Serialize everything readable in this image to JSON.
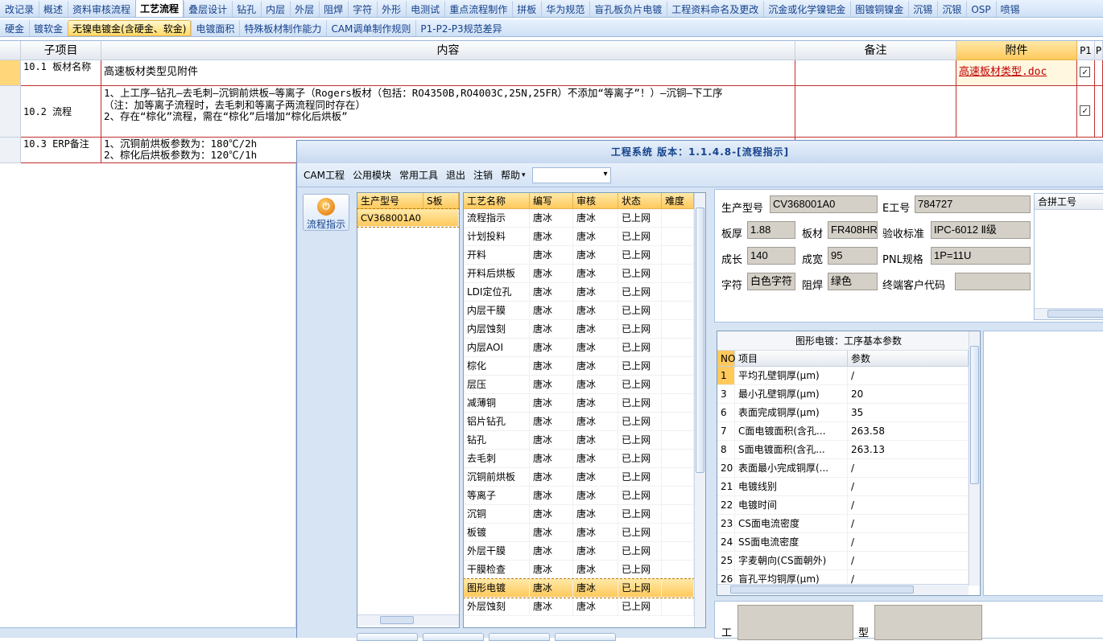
{
  "tabs_row1": [
    "改记录",
    "概述",
    "资料审核流程",
    "工艺流程",
    "叠层设计",
    "钻孔",
    "内层",
    "外层",
    "阻焊",
    "字符",
    "外形",
    "电测试",
    "重点流程制作",
    "拼板",
    "华为规范",
    "盲孔板负片电镀",
    "工程资料命名及更改",
    "沉金或化学镍钯金",
    "图镀铜镍金",
    "沉锡",
    "沉银",
    "OSP",
    "喷锡"
  ],
  "tabs_row1_active": "工艺流程",
  "tabs_row2": [
    "硬金",
    "镀软金",
    "无镍电镀金(含硬金、软金)",
    "电镀面积",
    "特殊板材制作能力",
    "CAM调单制作规则",
    "P1-P2-P3规范差异"
  ],
  "tabs_row2_active": "无镍电镀金(含硬金、软金)",
  "grid": {
    "headers": {
      "sub_item": "子项目",
      "content": "内容",
      "remark": "备注",
      "attachment": "附件",
      "p1": "P1",
      "p2": "P"
    },
    "rows": [
      {
        "sub": "10.1 板材名称",
        "content": "高速板材类型见附件",
        "remark": "",
        "attachment": "高速板材类型.doc",
        "p1_checked": true
      },
      {
        "sub": "10.2 流程",
        "content": "1、上工序—钻孔—去毛刺—沉铜前烘板—等离子（Rogers板材（包括：RO4350B,RO4003C,25N,25FR）不添加“等离子”！）—沉铜—下工序\n（注：加等离子流程时，去毛刺和等离子两流程同时存在）\n2、存在“棕化”流程，需在“棕化”后增加“棕化后烘板”",
        "remark": "",
        "attachment": "",
        "p1_checked": true
      },
      {
        "sub": "10.3 ERP备注",
        "content": "1、沉铜前烘板参数为：180℃/2h\n2、棕化后烘板参数为：120℃/1h",
        "remark": "",
        "attachment": "",
        "p1_checked": false
      }
    ]
  },
  "dialog": {
    "title": "工程系统 版本：1.1.4.8-[流程指示]",
    "menu": [
      "CAM工程",
      "公用模块",
      "常用工具",
      "退出",
      "注销",
      "帮助"
    ],
    "nav_button": "流程指示",
    "model_list": {
      "headers": [
        "生产型号",
        "S板"
      ],
      "items": [
        "CV368001A0"
      ]
    },
    "process_table": {
      "headers": [
        "工艺名称",
        "编写",
        "审核",
        "状态",
        "难度"
      ],
      "rows": [
        [
          "流程指示",
          "唐冰",
          "唐冰",
          "已上网",
          ""
        ],
        [
          "计划投料",
          "唐冰",
          "唐冰",
          "已上网",
          ""
        ],
        [
          "开料",
          "唐冰",
          "唐冰",
          "已上网",
          ""
        ],
        [
          "开料后烘板",
          "唐冰",
          "唐冰",
          "已上网",
          ""
        ],
        [
          "LDI定位孔",
          "唐冰",
          "唐冰",
          "已上网",
          ""
        ],
        [
          "内层干膜",
          "唐冰",
          "唐冰",
          "已上网",
          ""
        ],
        [
          "内层蚀刻",
          "唐冰",
          "唐冰",
          "已上网",
          ""
        ],
        [
          "内层AOI",
          "唐冰",
          "唐冰",
          "已上网",
          ""
        ],
        [
          "棕化",
          "唐冰",
          "唐冰",
          "已上网",
          ""
        ],
        [
          "层压",
          "唐冰",
          "唐冰",
          "已上网",
          ""
        ],
        [
          "减薄铜",
          "唐冰",
          "唐冰",
          "已上网",
          ""
        ],
        [
          "铝片钻孔",
          "唐冰",
          "唐冰",
          "已上网",
          ""
        ],
        [
          "钻孔",
          "唐冰",
          "唐冰",
          "已上网",
          ""
        ],
        [
          "去毛刺",
          "唐冰",
          "唐冰",
          "已上网",
          ""
        ],
        [
          "沉铜前烘板",
          "唐冰",
          "唐冰",
          "已上网",
          ""
        ],
        [
          "等离子",
          "唐冰",
          "唐冰",
          "已上网",
          ""
        ],
        [
          "沉铜",
          "唐冰",
          "唐冰",
          "已上网",
          ""
        ],
        [
          "板镀",
          "唐冰",
          "唐冰",
          "已上网",
          ""
        ],
        [
          "外层干膜",
          "唐冰",
          "唐冰",
          "已上网",
          ""
        ],
        [
          "干膜检查",
          "唐冰",
          "唐冰",
          "已上网",
          ""
        ],
        [
          "图形电镀",
          "唐冰",
          "唐冰",
          "已上网",
          ""
        ],
        [
          "外层蚀刻",
          "唐冰",
          "唐冰",
          "已上网",
          ""
        ]
      ],
      "selected": "图形电镀"
    },
    "info": {
      "model_label": "生产型号",
      "model": "CV368001A0",
      "e_label": "E工号",
      "e": "784727",
      "thick_label": "板厚",
      "thick": "1.88",
      "mat_label": "板材",
      "mat": "FR408HR",
      "std_label": "验收标准",
      "std": "IPC-6012 Ⅱ级",
      "len_label": "成长",
      "len": "140",
      "wid_label": "成宽",
      "wid": "95",
      "pnl_label": "PNL规格",
      "pnl": "1P=11U",
      "char_label": "字符",
      "char": "白色字符",
      "mask_label": "阻焊",
      "mask": "绿色",
      "cust_label": "终端客户代码",
      "cust": "",
      "combine_label": "合拼工号"
    },
    "params": {
      "title": "图形电镀：工序基本参数",
      "headers": [
        "NO",
        "项目",
        "参数"
      ],
      "rows": [
        [
          "1",
          "平均孔壁铜厚(μm)",
          "/"
        ],
        [
          "3",
          "最小孔壁铜厚(μm)",
          "20"
        ],
        [
          "6",
          "表面完成铜厚(μm)",
          "35"
        ],
        [
          "7",
          "C面电镀面积(含孔...",
          "263.58"
        ],
        [
          "8",
          "S面电镀面积(含孔...",
          "263.13"
        ],
        [
          "20",
          "表面最小完成铜厚(...",
          "/"
        ],
        [
          "21",
          "电镀线别",
          "/"
        ],
        [
          "22",
          "电镀时间",
          "/"
        ],
        [
          "23",
          "CS面电流密度",
          "/"
        ],
        [
          "24",
          "SS面电流密度",
          "/"
        ],
        [
          "25",
          "字麦朝向(CS面朝外)",
          "/"
        ],
        [
          "26",
          "盲孔平均铜厚(μm)",
          "/"
        ]
      ]
    },
    "bottom_labels": {
      "work": "工",
      "type": "型"
    }
  },
  "colors": {
    "accent": "#ffc95c",
    "border_red": "#c03030",
    "link": "#c00000",
    "tab_text": "#15428b"
  }
}
